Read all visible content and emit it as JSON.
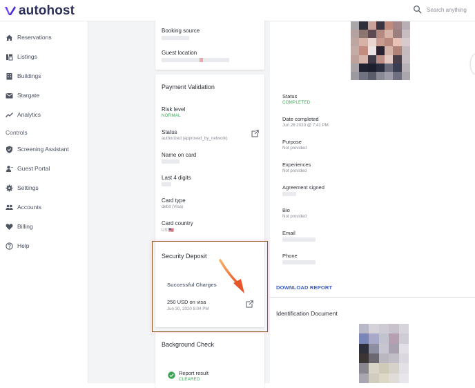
{
  "header": {
    "brand": "autohost",
    "search_placeholder": "Search anything",
    "icons": {
      "logo": "autohost-logo-icon",
      "search": "search-icon"
    }
  },
  "sidebar": {
    "items": [
      {
        "label": "Reservations",
        "icon": "home-icon"
      },
      {
        "label": "Listings",
        "icon": "listings-icon"
      },
      {
        "label": "Buildings",
        "icon": "building-icon"
      },
      {
        "label": "Stargate",
        "icon": "mail-icon"
      },
      {
        "label": "Analytics",
        "icon": "trend-icon"
      }
    ],
    "section_label": "Controls",
    "controls": [
      {
        "label": "Screening Assistant",
        "icon": "shield-icon"
      },
      {
        "label": "Guest Portal",
        "icon": "person-icon"
      },
      {
        "label": "Settings",
        "icon": "gear-icon"
      },
      {
        "label": "Accounts",
        "icon": "people-icon"
      },
      {
        "label": "Billing",
        "icon": "heart-icon"
      },
      {
        "label": "Help",
        "icon": "help-icon"
      }
    ]
  },
  "booking": {
    "source_label": "Booking source",
    "location_label": "Guest location"
  },
  "payment": {
    "title": "Payment Validation",
    "risk_label": "Risk level",
    "risk_value": "NORMAL",
    "status_label": "Status",
    "status_value": "authorized (approved_by_network)",
    "name_label": "Name on card",
    "last4_label": "Last 4 digits",
    "card_type_label": "Card type",
    "card_type_value": "debit (Visa)",
    "country_label": "Card country",
    "country_value": "US 🇺🇸"
  },
  "deposit": {
    "title": "Security Deposit",
    "subtitle": "Successful Charges",
    "charge_amount": "250 USD on visa",
    "charge_date": "Jun 30, 2020 8:04 PM"
  },
  "background": {
    "title": "Background Check",
    "report_label": "Report result",
    "report_value": "CLEARED"
  },
  "guest": {
    "status_label": "Status",
    "status_value": "COMPLETED",
    "date_label": "Date completed",
    "date_value": "Jun 26 2020 @ 7:41 PM",
    "purpose_label": "Purpose",
    "purpose_value": "Not provided",
    "experiences_label": "Experiences",
    "experiences_value": "Not provided",
    "agreement_label": "Agreement signed",
    "bio_label": "Bio",
    "bio_value": "Not provided",
    "email_label": "Email",
    "phone_label": "Phone",
    "download_label": "DOWNLOAD REPORT",
    "id_doc_label": "Identification Document"
  },
  "colors": {
    "accent_blue": "#3a5cc4",
    "success_green": "#3aa655",
    "highlight_border": "#8a5a1c",
    "arrow": "#e8552a"
  }
}
